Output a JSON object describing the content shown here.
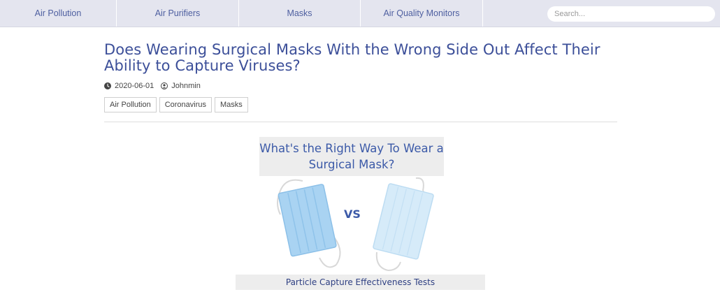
{
  "nav": {
    "items": [
      {
        "label": "Air Pollution"
      },
      {
        "label": "Air Purifiers"
      },
      {
        "label": "Masks"
      },
      {
        "label": "Air Quality Monitors"
      }
    ],
    "search_placeholder": "Search..."
  },
  "article": {
    "title": "Does Wearing Surgical Masks With the Wrong Side Out Affect Their Ability to Capture Viruses?",
    "date": "2020-06-01",
    "author": "Johnmin",
    "tags": [
      {
        "label": "Air Pollution"
      },
      {
        "label": "Coronavirus"
      },
      {
        "label": "Masks"
      }
    ]
  },
  "figure": {
    "heading_line1": "What's the Right Way To Wear a",
    "heading_line2": "Surgical Mask?",
    "vs": "VS",
    "caption": "Particle Capture Effectiveness Tests"
  },
  "colors": {
    "nav_bg": "#e4e5ef",
    "link": "#4e5fa0",
    "title": "#3c4f99",
    "figure_text": "#3c5aa8"
  },
  "icons": {
    "date": "clock-icon",
    "author": "user-icon"
  }
}
